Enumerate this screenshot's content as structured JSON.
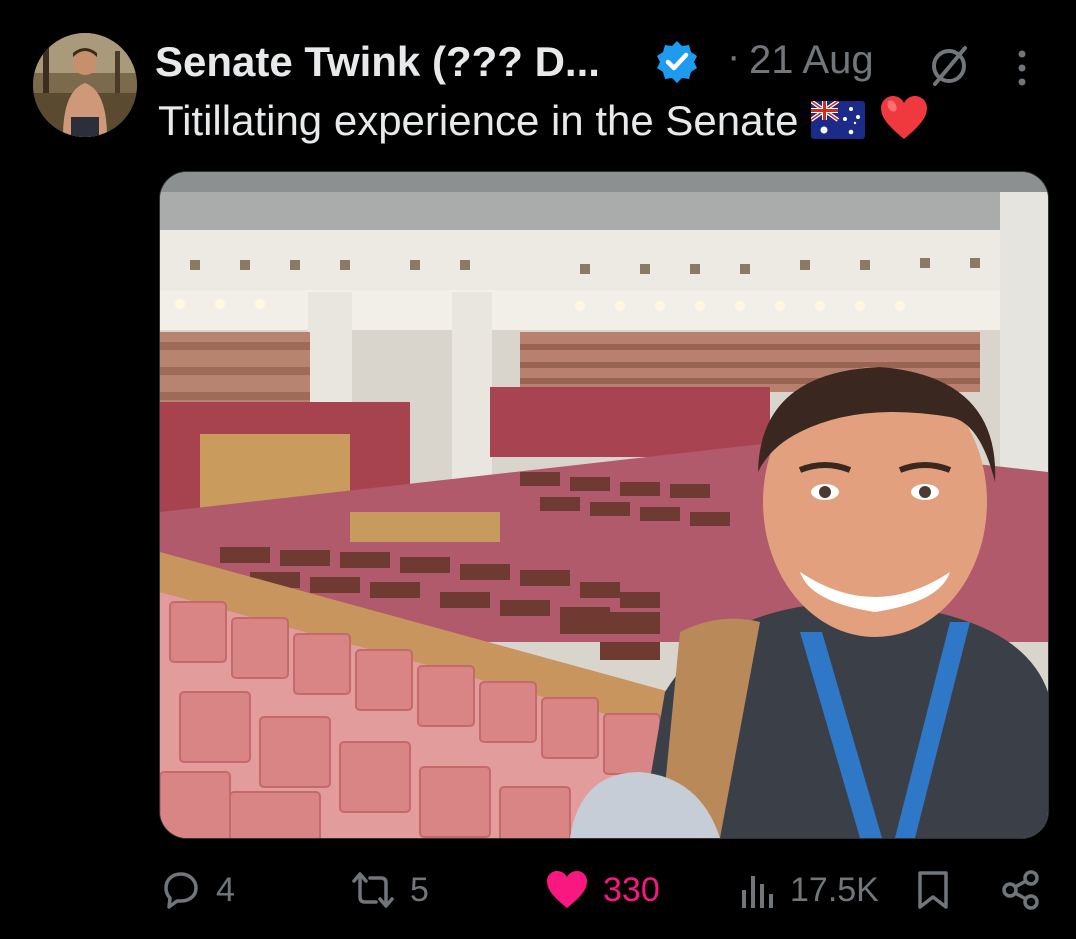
{
  "tweet": {
    "author_name": "Senate Twink (??? D...",
    "date": "21 Aug",
    "text": "Titillating experience in the Senate",
    "emoji_flag": "australia-flag",
    "emoji_heart": "red-heart"
  },
  "actions": {
    "replies": "4",
    "retweets": "5",
    "likes": "330",
    "views": "17.5K"
  },
  "colors": {
    "background": "#000000",
    "text_primary": "#e7e9ea",
    "text_secondary": "#71767b",
    "verified_blue": "#1d9bf0",
    "like_pink": "#f91880"
  }
}
